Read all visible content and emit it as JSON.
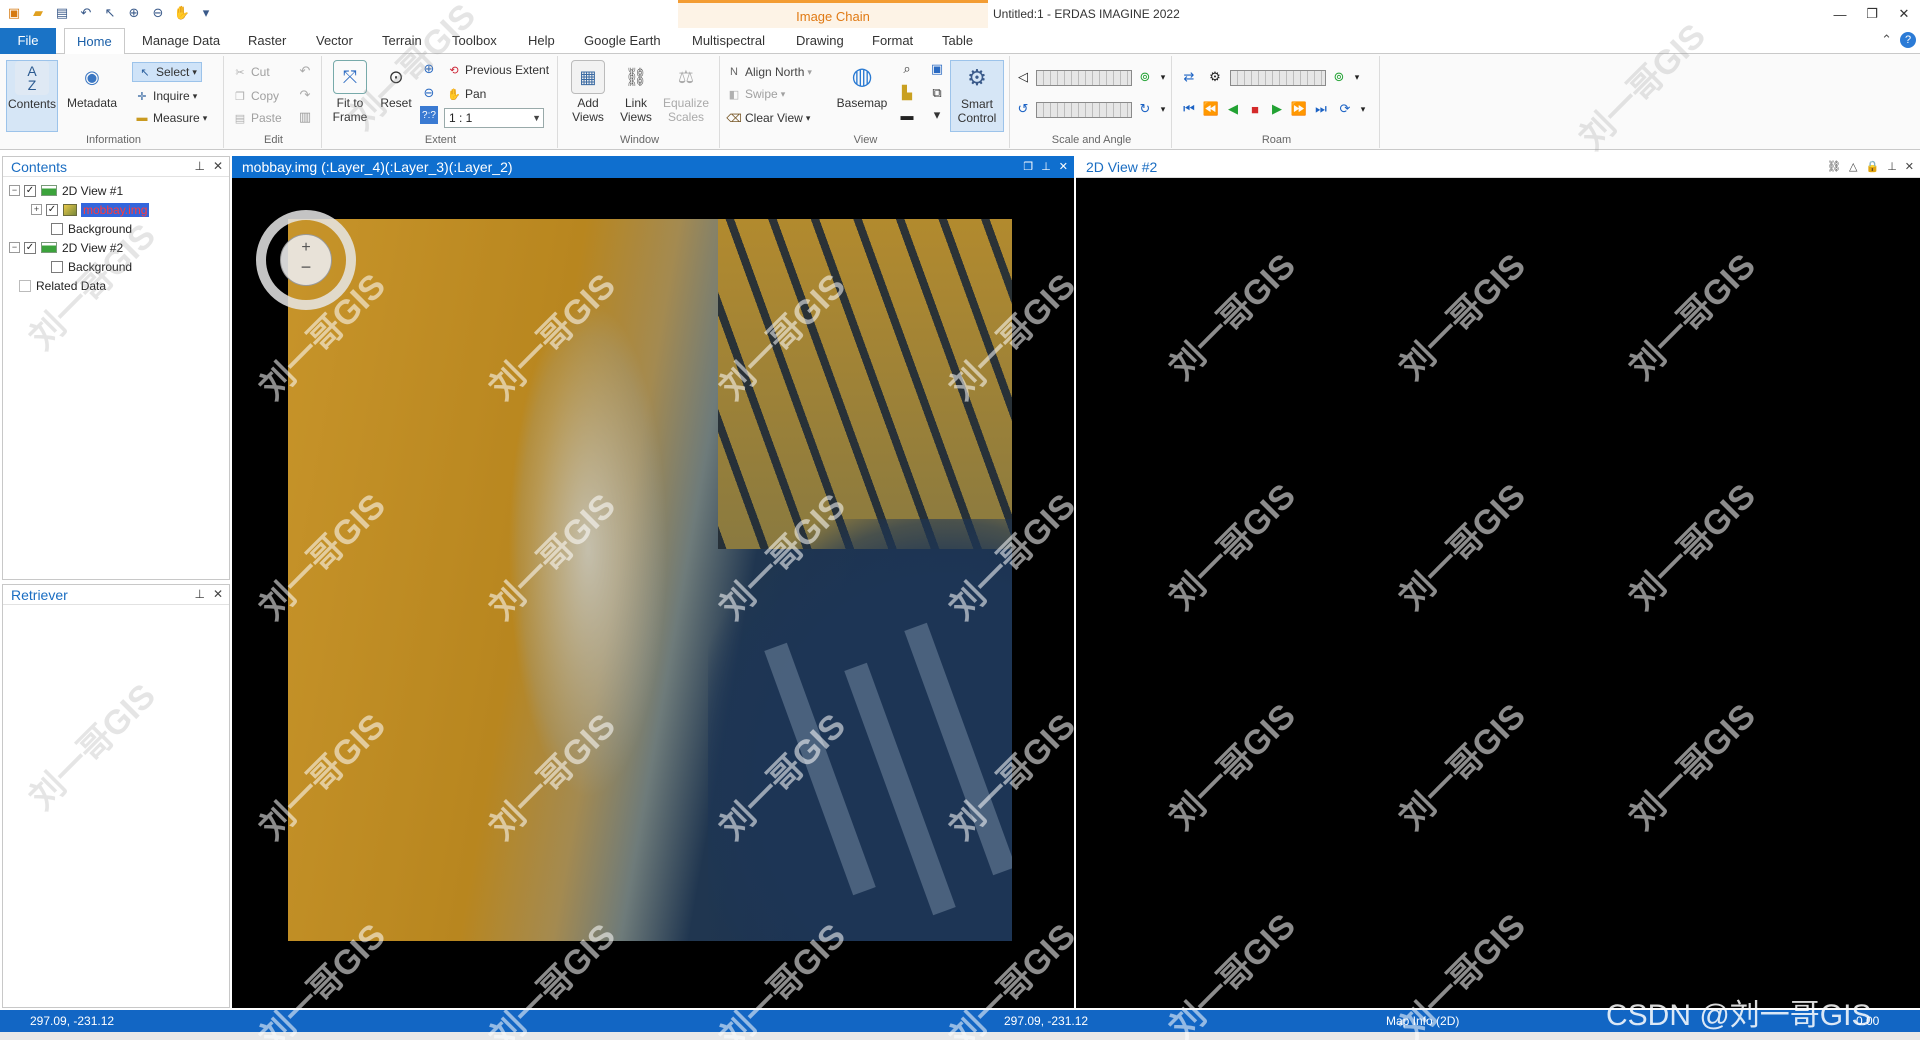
{
  "window": {
    "title": "Untitled:1 - ERDAS IMAGINE 2022",
    "context_tab": "Image Chain"
  },
  "ribbon_tabs": [
    "File",
    "Home",
    "Manage Data",
    "Raster",
    "Vector",
    "Terrain",
    "Toolbox",
    "Help",
    "Google Earth",
    "Multispectral",
    "Drawing",
    "Format",
    "Table"
  ],
  "groups": {
    "information": {
      "label": "Information",
      "contents": "Contents",
      "metadata": "Metadata",
      "select": "Select",
      "inquire": "Inquire",
      "measure": "Measure"
    },
    "edit": {
      "label": "Edit",
      "cut": "Cut",
      "copy": "Copy",
      "paste": "Paste"
    },
    "extent": {
      "label": "Extent",
      "fit_to_frame_1": "Fit to",
      "fit_to_frame_2": "Frame",
      "reset": "Reset",
      "previous_extent": "Previous Extent",
      "pan": "Pan",
      "scale": "1 : 1",
      "qq": "?:?"
    },
    "window": {
      "label": "Window",
      "add_views_1": "Add",
      "add_views_2": "Views",
      "link_views_1": "Link",
      "link_views_2": "Views",
      "equalize_1": "Equalize",
      "equalize_2": "Scales",
      "align_north": "Align North",
      "swipe": "Swipe",
      "clear_view": "Clear View"
    },
    "view": {
      "label": "View",
      "basemap": "Basemap",
      "smart_1": "Smart",
      "smart_2": "Control"
    },
    "scale_angle": {
      "label": "Scale and Angle"
    },
    "roam": {
      "label": "Roam"
    }
  },
  "contents_panel": {
    "title": "Contents",
    "items": [
      {
        "label": "2D View #1"
      },
      {
        "label": "mobbay.img"
      },
      {
        "label": "Background"
      },
      {
        "label": "2D View #2"
      },
      {
        "label": "Background"
      },
      {
        "label": "Related Data"
      }
    ]
  },
  "retriever_panel": {
    "title": "Retriever"
  },
  "viewers": {
    "left_title": "mobbay.img (:Layer_4)(:Layer_3)(:Layer_2)",
    "right_title": "2D View #2"
  },
  "status": {
    "left_coords": "297.09, -231.12",
    "mid_coords": "297.09, -231.12",
    "map_info": "Map Info (2D)",
    "scale": "0.00"
  },
  "watermark": {
    "text": "刘一哥GIS",
    "csdn": "CSDN @刘一哥GIS"
  }
}
